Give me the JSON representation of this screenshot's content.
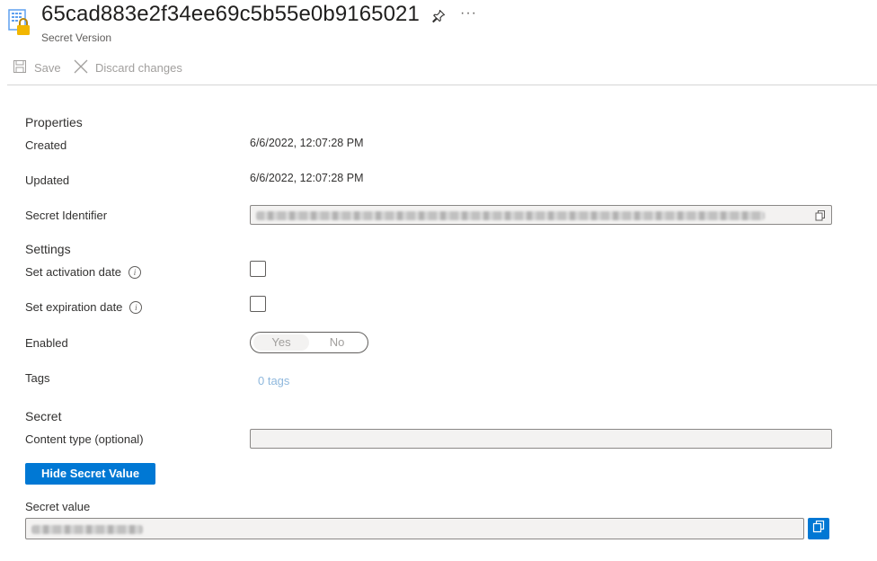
{
  "header": {
    "title": "65cad883e2f34ee69c5b55e0b9165021",
    "subtitle": "Secret Version",
    "more_label": "···",
    "icon": "key-vault-secret-icon"
  },
  "toolbar": {
    "save_label": "Save",
    "discard_label": "Discard changes"
  },
  "properties": {
    "section_title": "Properties",
    "created_label": "Created",
    "created_value": "6/6/2022, 12:07:28 PM",
    "updated_label": "Updated",
    "updated_value": "6/6/2022, 12:07:28 PM",
    "identifier_label": "Secret Identifier"
  },
  "settings": {
    "section_title": "Settings",
    "activation_label": "Set activation date",
    "expiration_label": "Set expiration date",
    "enabled_label": "Enabled",
    "enabled_yes": "Yes",
    "enabled_no": "No",
    "enabled_selected": "Yes",
    "tags_label": "Tags",
    "tags_link": "0 tags"
  },
  "secret": {
    "section_title": "Secret",
    "content_type_label": "Content type (optional)",
    "hide_button_label": "Hide Secret Value",
    "value_label": "Secret value"
  },
  "colors": {
    "accent": "#0078d4",
    "link": "#8fb8dd",
    "disabled_text": "#a19f9d"
  }
}
